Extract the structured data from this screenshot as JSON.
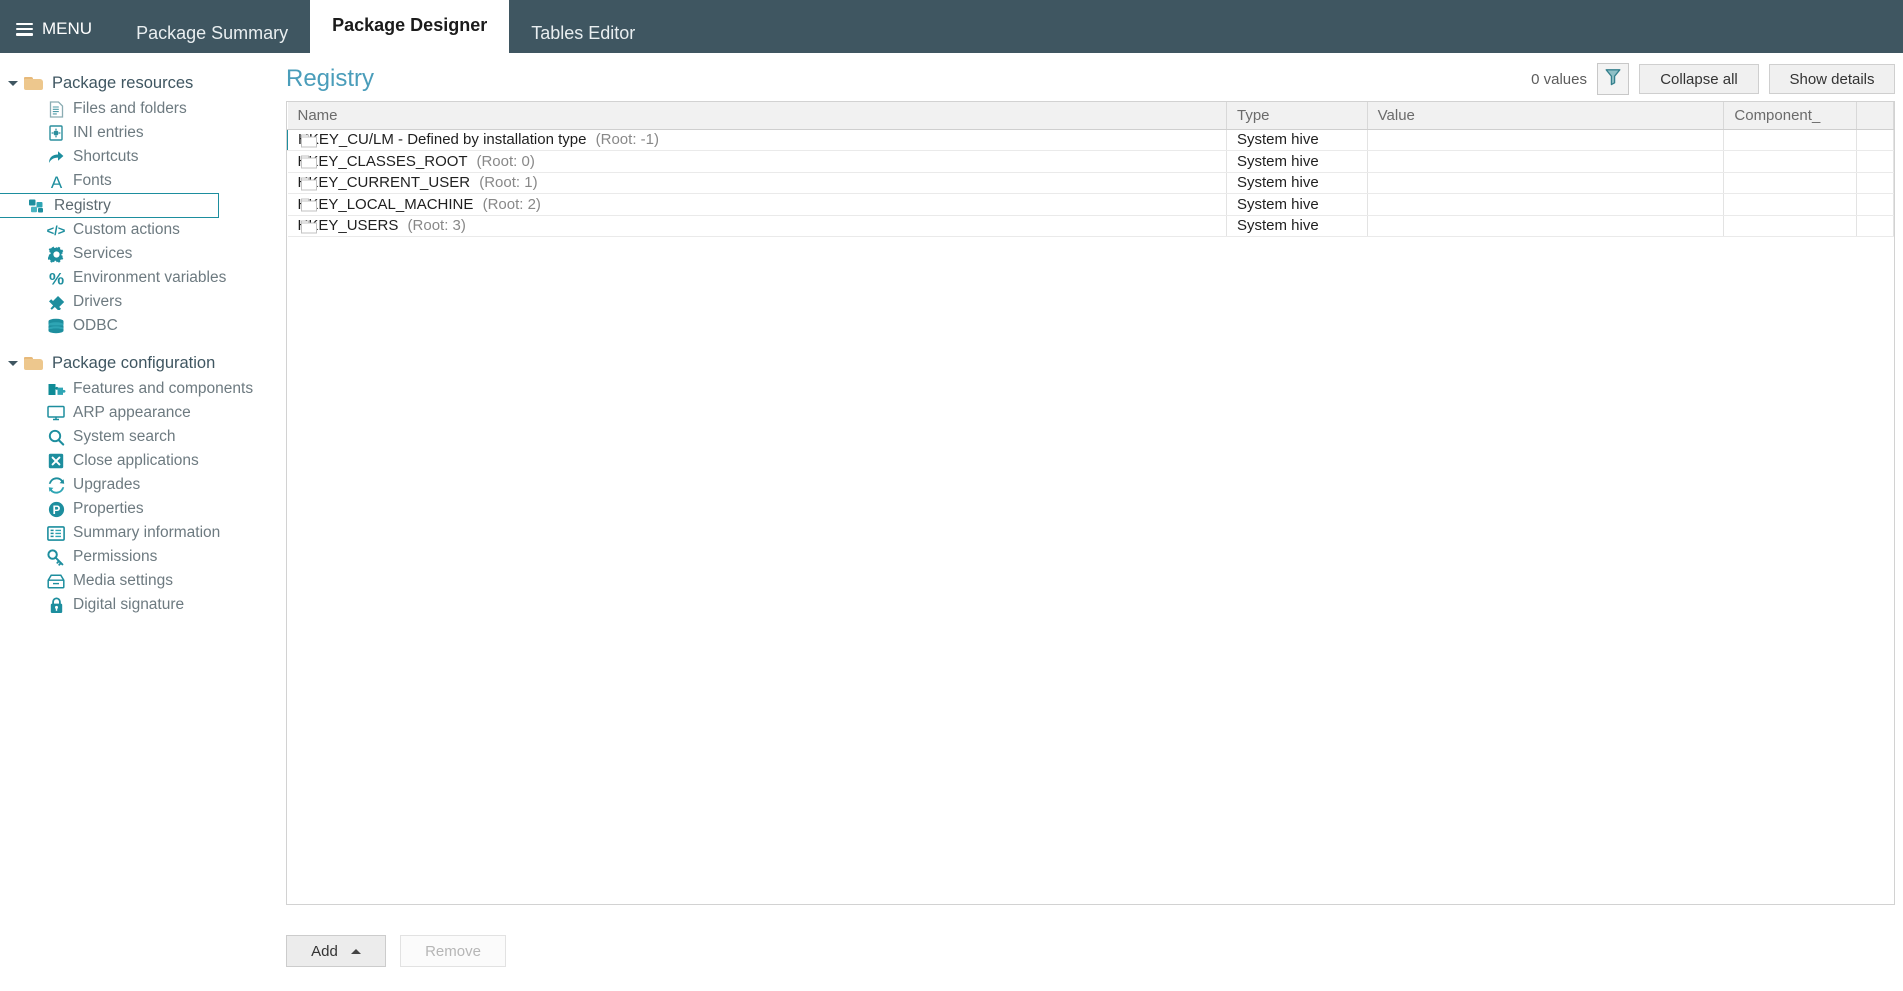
{
  "header": {
    "menu_label": "MENU",
    "tabs": [
      {
        "label": "Package Summary",
        "active": false
      },
      {
        "label": "Package Designer",
        "active": true
      },
      {
        "label": "Tables Editor",
        "active": false
      }
    ],
    "background_color": "#3f5661"
  },
  "sidebar": {
    "groups": [
      {
        "label": "Package resources",
        "expanded": true,
        "items": [
          {
            "label": "Files and folders",
            "icon": "document-icon",
            "indent": 2,
            "selected": false
          },
          {
            "label": "INI entries",
            "icon": "ini-file-icon",
            "indent": 3,
            "selected": false
          },
          {
            "label": "Shortcuts",
            "icon": "shortcut-arrow-icon",
            "indent": 3,
            "selected": false
          },
          {
            "label": "Fonts",
            "icon": "font-letter-a-icon",
            "indent": 3,
            "selected": false
          },
          {
            "label": "Registry",
            "icon": "registry-blocks-icon",
            "indent": 2,
            "selected": true
          },
          {
            "label": "Custom actions",
            "icon": "code-brackets-icon",
            "indent": 2,
            "selected": false
          },
          {
            "label": "Services",
            "icon": "gear-icon",
            "indent": 2,
            "selected": false
          },
          {
            "label": "Environment variables",
            "icon": "percent-icon",
            "indent": 2,
            "selected": false
          },
          {
            "label": "Drivers",
            "icon": "plug-icon",
            "indent": 2,
            "selected": false
          },
          {
            "label": "ODBC",
            "icon": "database-icon",
            "indent": 2,
            "selected": false
          }
        ]
      },
      {
        "label": "Package configuration",
        "expanded": true,
        "items": [
          {
            "label": "Features and components",
            "icon": "puzzle-icon",
            "indent": 2,
            "selected": false
          },
          {
            "label": "ARP appearance",
            "icon": "monitor-icon",
            "indent": 2,
            "selected": false
          },
          {
            "label": "System search",
            "icon": "magnifier-icon",
            "indent": 2,
            "selected": false
          },
          {
            "label": "Close applications",
            "icon": "close-x-box-icon",
            "indent": 2,
            "selected": false
          },
          {
            "label": "Upgrades",
            "icon": "refresh-cycle-icon",
            "indent": 2,
            "selected": false
          },
          {
            "label": "Properties",
            "icon": "letter-p-circle-icon",
            "indent": 2,
            "selected": false
          },
          {
            "label": "Summary information",
            "icon": "list-lines-icon",
            "indent": 2,
            "selected": false
          },
          {
            "label": "Permissions",
            "icon": "key-icon",
            "indent": 2,
            "selected": false
          },
          {
            "label": "Media settings",
            "icon": "media-box-icon",
            "indent": 2,
            "selected": false
          },
          {
            "label": "Digital signature",
            "icon": "padlock-icon",
            "indent": 2,
            "selected": false
          }
        ]
      }
    ],
    "accent_color": "#1d8e9e",
    "folder_color": "#edc78d"
  },
  "main": {
    "title": "Registry",
    "title_color": "#4a9dba",
    "values_count_label": "0 values",
    "filter_icon": "funnel-filter-icon",
    "collapse_all_label": "Collapse all",
    "show_details_label": "Show details",
    "columns": [
      {
        "key": "name",
        "label": "Name"
      },
      {
        "key": "type",
        "label": "Type"
      },
      {
        "key": "value",
        "label": "Value"
      },
      {
        "key": "component",
        "label": "Component_"
      },
      {
        "key": "extra",
        "label": ""
      }
    ],
    "rows": [
      {
        "name": "HKEY_CU/LM - Defined by installation type",
        "root": "(Root: -1)",
        "type": "System hive",
        "value": "",
        "component": "",
        "selected": true
      },
      {
        "name": "HKEY_CLASSES_ROOT",
        "root": "(Root: 0)",
        "type": "System hive",
        "value": "",
        "component": "",
        "selected": false
      },
      {
        "name": "HKEY_CURRENT_USER",
        "root": "(Root: 1)",
        "type": "System hive",
        "value": "",
        "component": "",
        "selected": false
      },
      {
        "name": "HKEY_LOCAL_MACHINE",
        "root": "(Root: 2)",
        "type": "System hive",
        "value": "",
        "component": "",
        "selected": false
      },
      {
        "name": "HKEY_USERS",
        "root": "(Root: 3)",
        "type": "System hive",
        "value": "",
        "component": "",
        "selected": false
      }
    ],
    "selection_color": "#1d8e9e"
  },
  "footer": {
    "add_label": "Add",
    "remove_label": "Remove",
    "remove_enabled": false
  }
}
